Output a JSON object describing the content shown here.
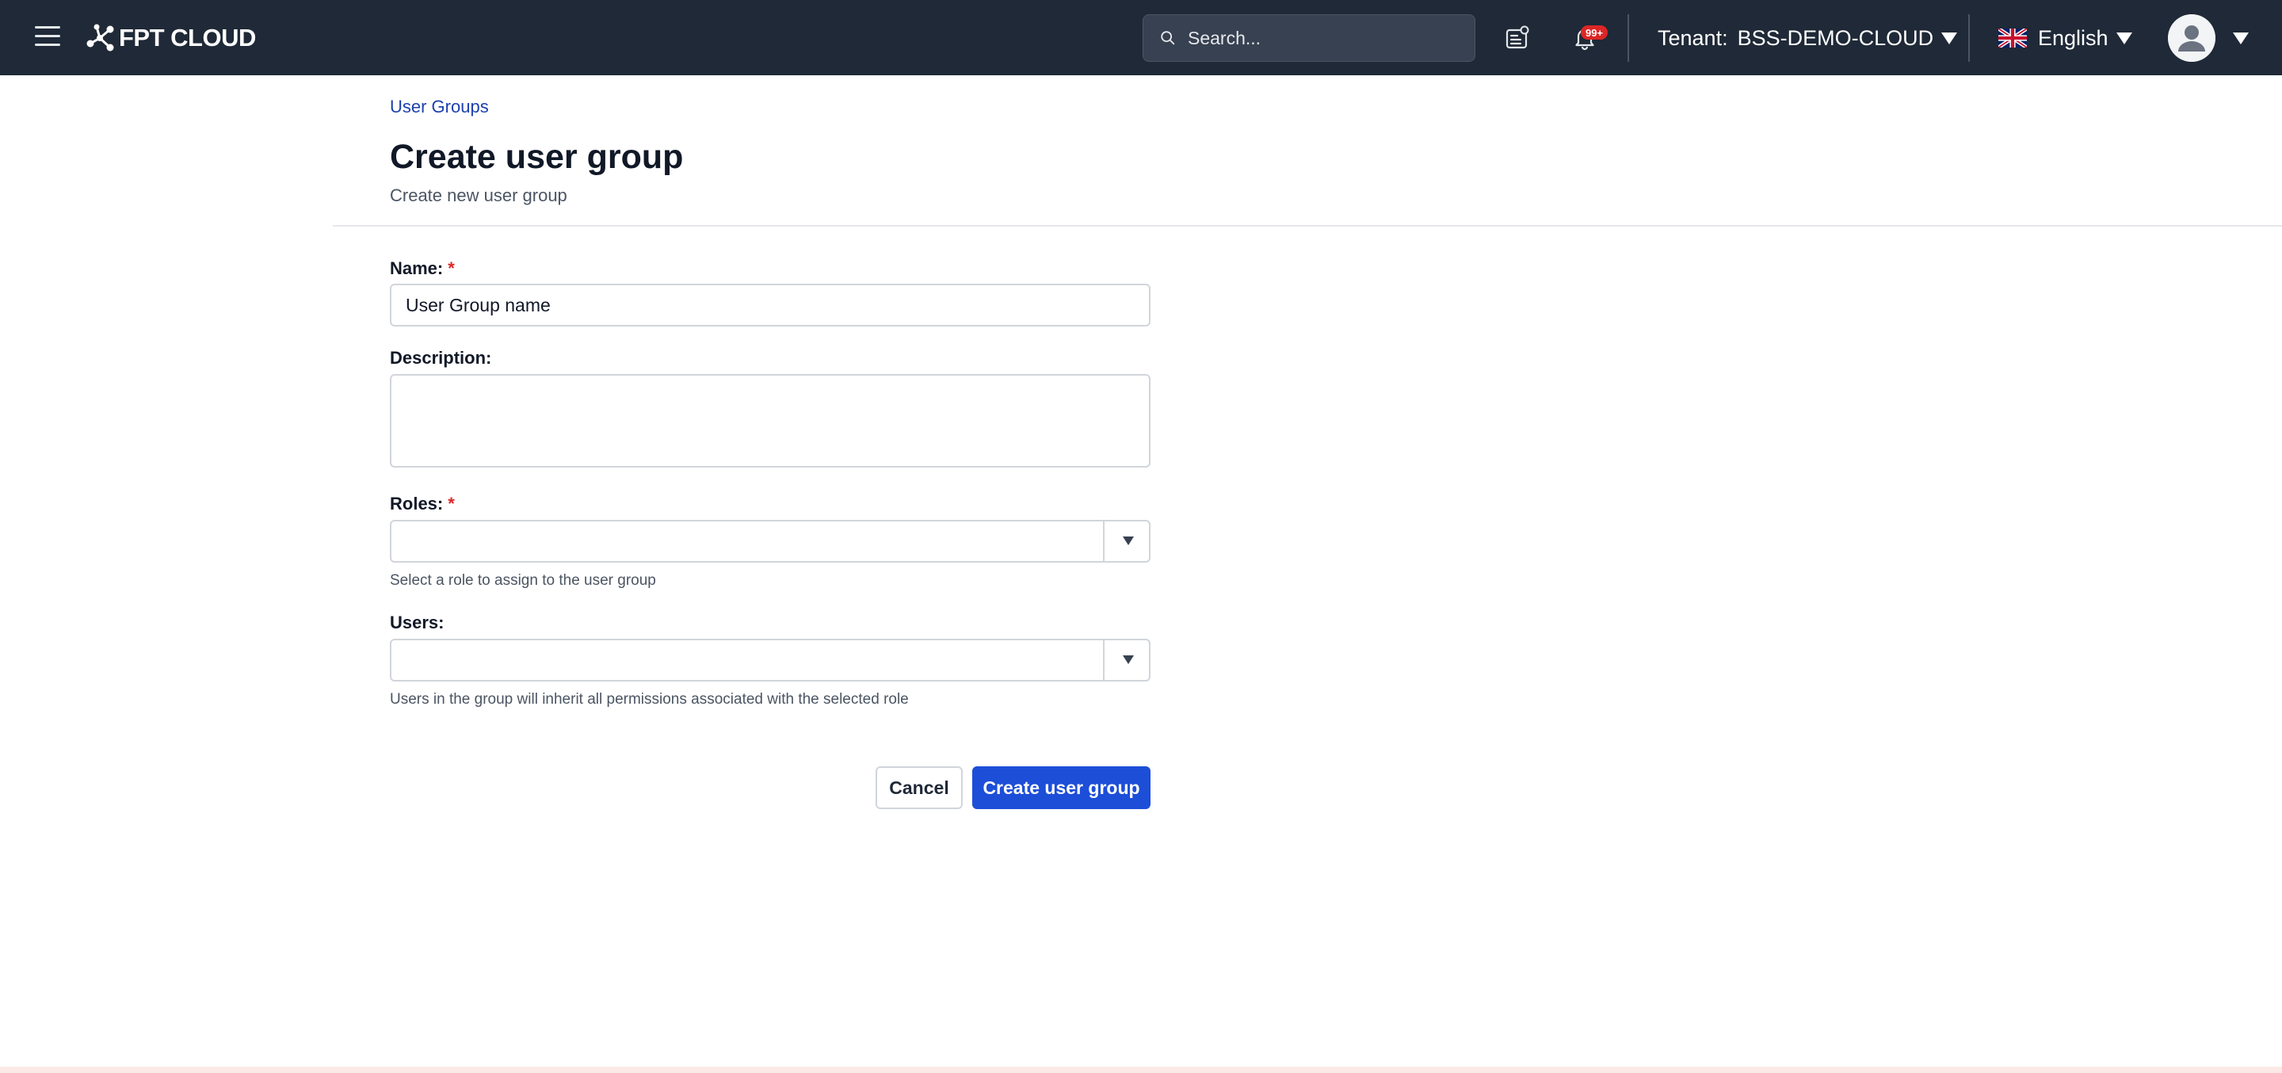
{
  "header": {
    "logo_text": "FPT CLOUD",
    "search_placeholder": "Search...",
    "notification_badge": "99+",
    "tenant_label": "Tenant:",
    "tenant_value": "BSS-DEMO-CLOUD",
    "language": "English"
  },
  "page": {
    "breadcrumb": "User Groups",
    "title": "Create user group",
    "subtitle": "Create new user group"
  },
  "form": {
    "name_label": "Name:",
    "name_placeholder": "User Group name",
    "description_label": "Description:",
    "roles_label": "Roles:",
    "roles_hint": "Select a role to assign to the user group",
    "users_label": "Users:",
    "users_hint": "Users in the group will inherit all permissions associated with the selected role",
    "required_mark": "*"
  },
  "actions": {
    "cancel_label": "Cancel",
    "create_label": "Create user group"
  },
  "colors": {
    "topbar": "#1f2937",
    "primary": "#1d4ed8",
    "required": "#dc2626",
    "link": "#1e40af"
  },
  "icons": {
    "menu": "hamburger-icon",
    "search": "search-icon",
    "tasks": "task-list-icon",
    "notifications": "bell-icon",
    "language": "uk-flag-icon",
    "user": "user-avatar-icon"
  }
}
